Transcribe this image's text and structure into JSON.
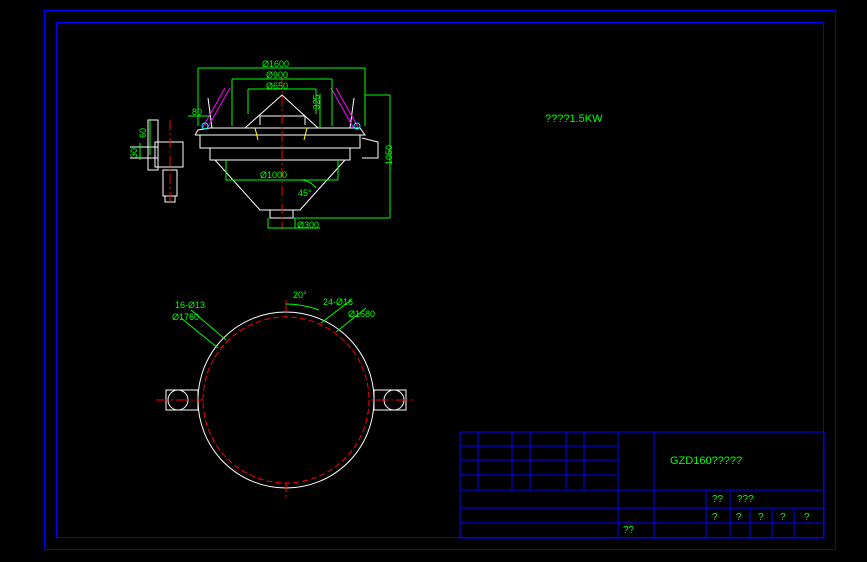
{
  "drawing": {
    "title": "GZD160?????",
    "annotation": "????1.5KW"
  },
  "dimensions": {
    "d1600": "Ø1600",
    "d900": "Ø900",
    "d650": "Ø650",
    "d1000": "Ø1000",
    "d300": "Ø300",
    "d1760": "Ø1760",
    "d1680": "Ø1680",
    "holes1": "16-Ø13",
    "holes2": "24-Ø16",
    "h1050": "1050",
    "h325": "325",
    "h60": "60",
    "h30": "30",
    "w80": "80",
    "ang45": "45°",
    "ang20": "20°"
  },
  "titleblock": {
    "field1": "??",
    "field2": "???",
    "field3": "??",
    "field4": "?",
    "field5": "?",
    "field6": "?",
    "field7": "?",
    "field8": "?"
  }
}
